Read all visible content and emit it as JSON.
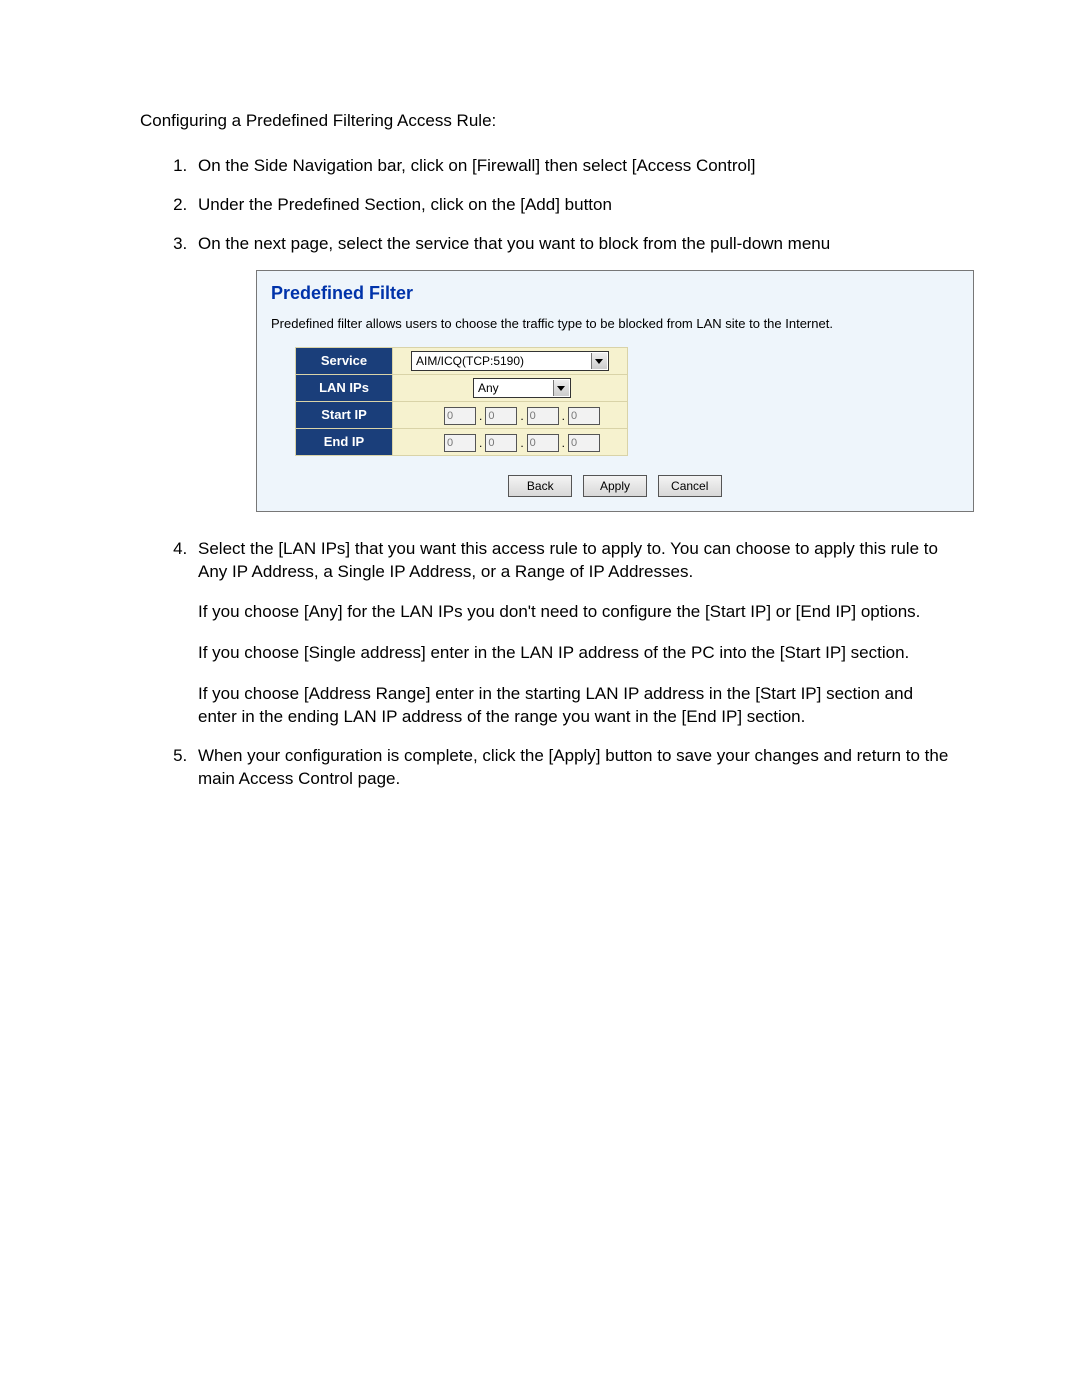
{
  "doc": {
    "intro": "Configuring a Predefined Filtering Access Rule:",
    "steps": {
      "s1": "On the Side Navigation bar, click on [Firewall] then select [Access Control]",
      "s2": "Under the Predefined Section, click on the [Add] button",
      "s3": "On the next page, select the service that you want to block from the pull-down menu",
      "s4a": "Select the [LAN IPs] that you want this access rule to apply to. You can choose to apply this rule to Any IP Address, a Single IP Address, or a Range of IP Addresses.",
      "s4b": "If you choose [Any] for the LAN IPs you don't need to configure the [Start IP] or [End IP] options.",
      "s4c": "If you choose [Single address] enter in the LAN IP address of the PC into the [Start IP] section.",
      "s4d": "If you choose [Address Range] enter in the starting LAN IP address in the [Start IP] section and enter in the ending LAN IP address of the range you want in the [End IP] section.",
      "s5": "When your configuration is complete, click the [Apply] button to save your changes and return to the main Access Control page."
    }
  },
  "panel": {
    "title": "Predefined Filter",
    "desc": "Predefined filter allows users to choose the traffic type to be blocked from LAN site to the Internet.",
    "labels": {
      "service": "Service",
      "lanips": "LAN IPs",
      "startip": "Start IP",
      "endip": "End IP"
    },
    "values": {
      "service": "AIM/ICQ(TCP:5190)",
      "lanips": "Any",
      "ip_octet": "0"
    },
    "buttons": {
      "back": "Back",
      "apply": "Apply",
      "cancel": "Cancel"
    }
  }
}
